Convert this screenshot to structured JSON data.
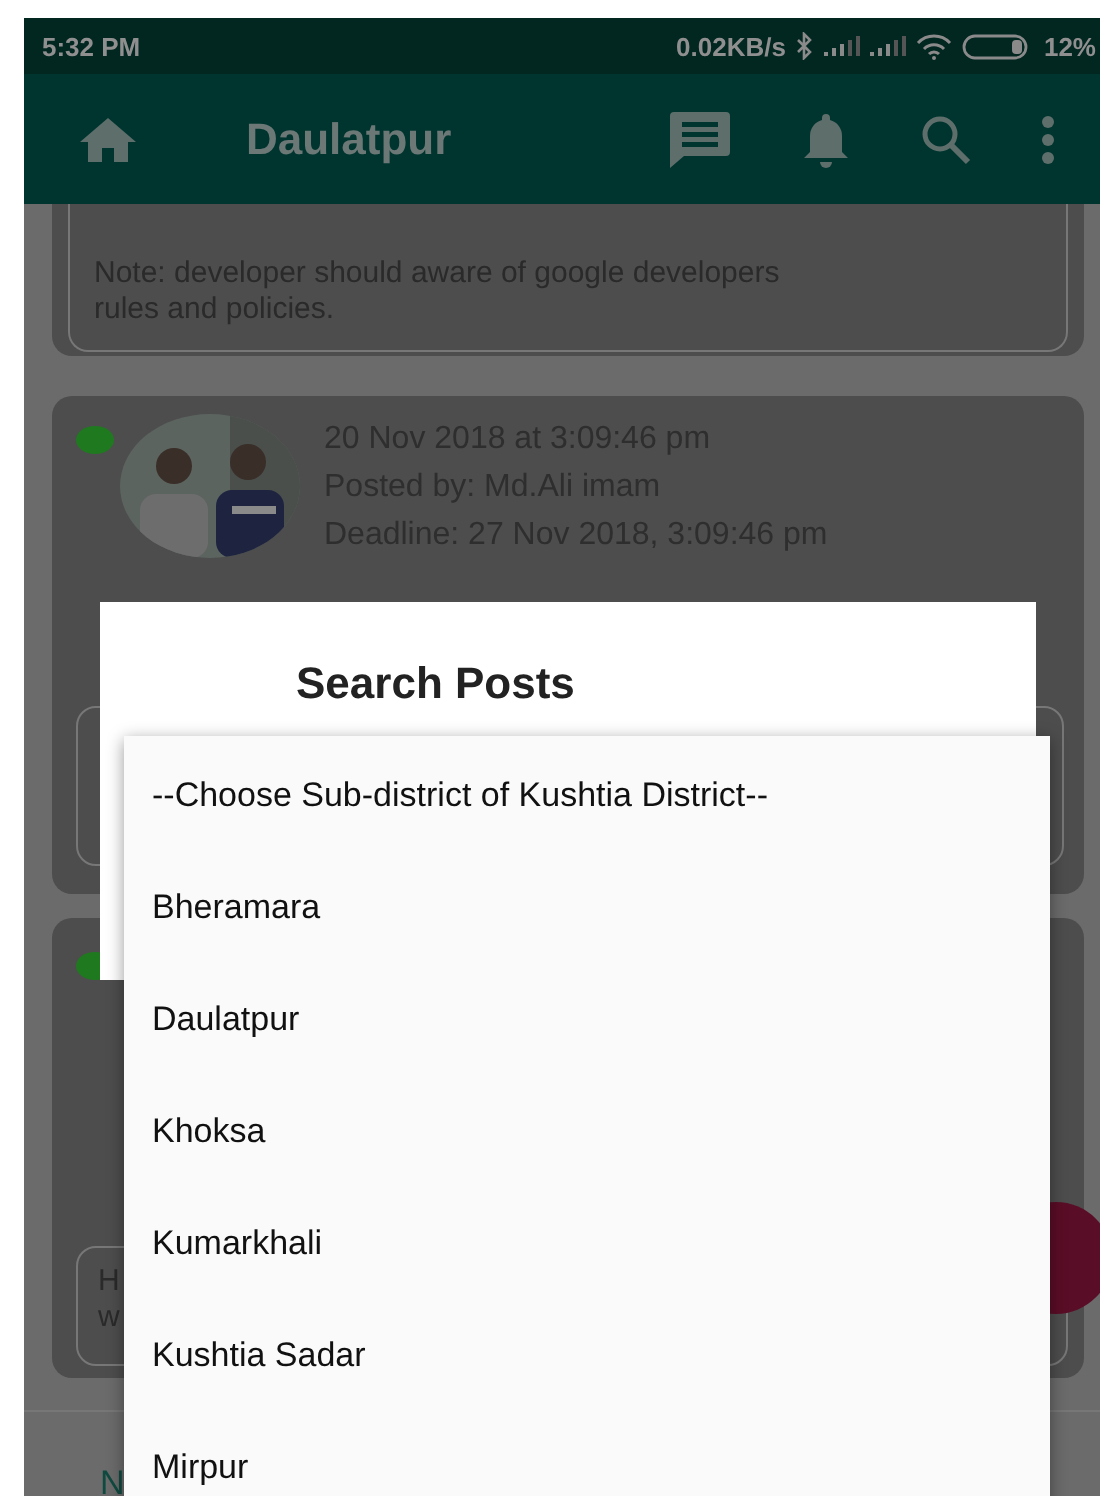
{
  "status_bar": {
    "time": "5:32 PM",
    "speed": "0.02KB/s",
    "battery": "12%"
  },
  "app_bar": {
    "title": "Daulatpur"
  },
  "posts": [
    {
      "kind": "note",
      "note": "Note: developer should aware of google developers rules and policies."
    },
    {
      "kind": "post",
      "online": true,
      "date": "20 Nov 2018 at 3:09:46 pm",
      "posted_by": "Posted by: Md.Ali imam",
      "deadline": "Deadline: 27 Nov 2018, 3:09:46 pm"
    },
    {
      "kind": "post_partial",
      "online": true,
      "note_lines": [
        "H",
        "w"
      ]
    }
  ],
  "footer_text": "N",
  "dialog": {
    "title": "Search Posts"
  },
  "dropdown": {
    "options": [
      "--Choose Sub-district of Kushtia District--",
      "Bheramara",
      "Daulatpur",
      "Khoksa",
      "Kumarkhali",
      "Kushtia Sadar",
      "Mirpur"
    ]
  }
}
